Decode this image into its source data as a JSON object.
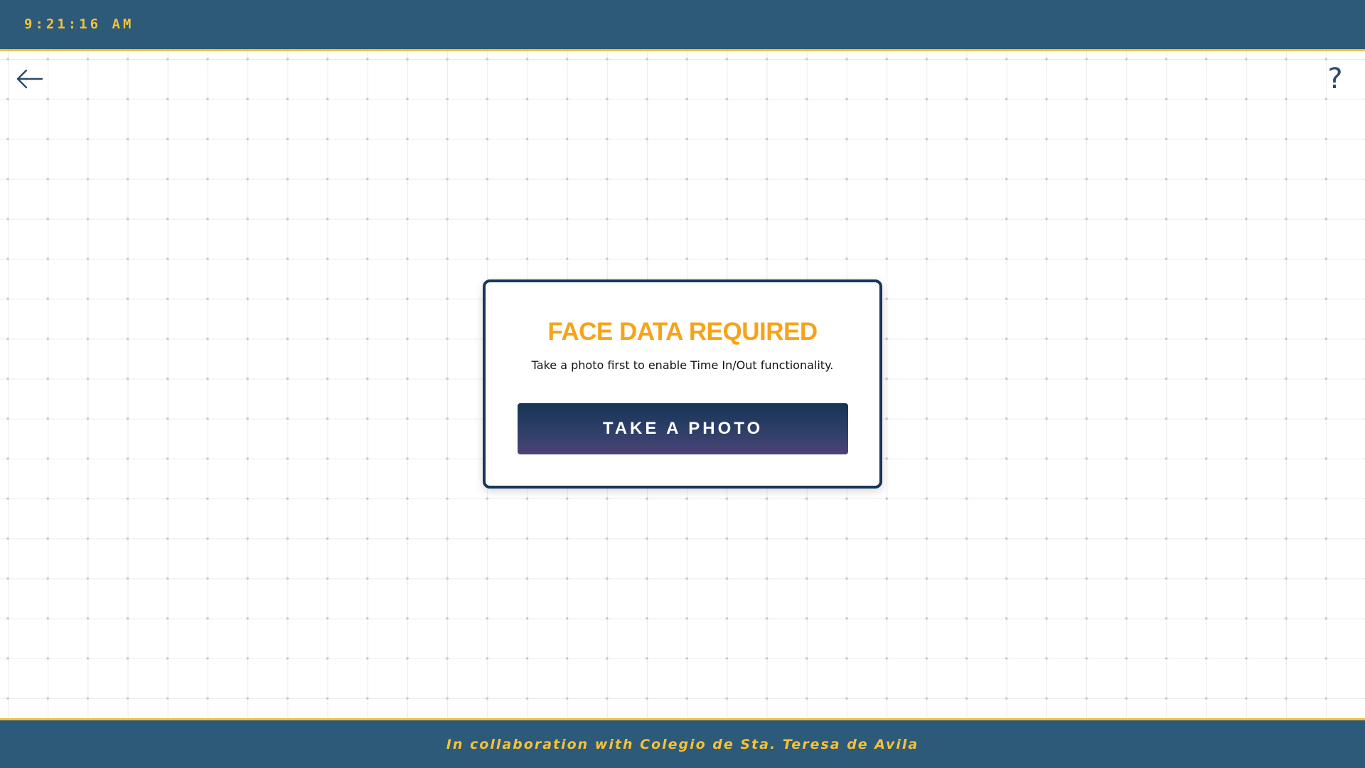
{
  "header": {
    "clock": "9:21:16 AM"
  },
  "nav": {
    "back_icon": "arrow-left-icon",
    "help_label": "?"
  },
  "dialog": {
    "title": "FACE DATA REQUIRED",
    "message": "Take a photo first to enable Time In/Out functionality.",
    "button_label": "TAKE A PHOTO"
  },
  "footer": {
    "text": "In collaboration with Colegio de Sta. Teresa de Avila"
  },
  "colors": {
    "primary": "#2c5a78",
    "accent": "#f5c13a",
    "title": "#f7a31a",
    "card_border": "#16375a"
  }
}
